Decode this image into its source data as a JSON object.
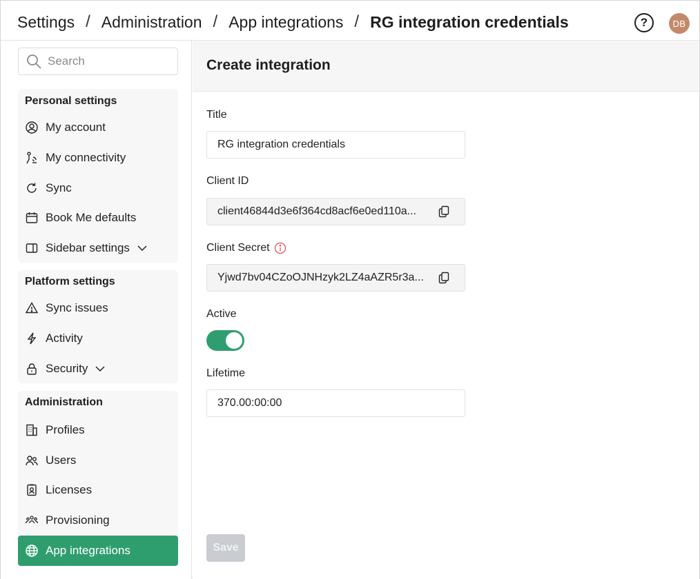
{
  "breadcrumb": [
    "Settings",
    "Administration",
    "App integrations",
    "RG integration credentials"
  ],
  "header": {
    "help_icon": "help-circle-icon",
    "avatar_initials": "DB",
    "avatar_color": "#c28a6a"
  },
  "search": {
    "placeholder": "Search"
  },
  "sidebar": {
    "personal": {
      "title": "Personal settings",
      "items": [
        {
          "label": "My account",
          "icon": "user-circle-icon"
        },
        {
          "label": "My connectivity",
          "icon": "connectivity-icon"
        },
        {
          "label": "Sync",
          "icon": "sync-icon"
        },
        {
          "label": "Book Me defaults",
          "icon": "calendar-icon"
        },
        {
          "label": "Sidebar settings",
          "icon": "sidebar-icon"
        }
      ]
    },
    "platform": {
      "title": "Platform settings",
      "items": [
        {
          "label": "Sync issues",
          "icon": "warning-icon"
        },
        {
          "label": "Activity",
          "icon": "lightning-icon"
        },
        {
          "label": "Security",
          "icon": "lock-icon"
        }
      ]
    },
    "administration": {
      "title": "Administration",
      "items": [
        {
          "label": "Profiles",
          "icon": "building-icon"
        },
        {
          "label": "Users",
          "icon": "users-icon"
        },
        {
          "label": "Licenses",
          "icon": "license-badge-icon"
        },
        {
          "label": "Provisioning",
          "icon": "group-icon"
        },
        {
          "label": "App integrations",
          "icon": "globe-icon",
          "active": true
        }
      ]
    }
  },
  "form": {
    "heading": "Create integration",
    "title_label": "Title",
    "title_value": "RG integration credentials",
    "client_id_label": "Client ID",
    "client_id_value": "client46844d3e6f364cd8acf6e0ed110a...",
    "client_secret_label": "Client Secret",
    "client_secret_value": "Yjwd7bv04CZoOJNHzyk2LZ4aAZR5r3a...",
    "active_label": "Active",
    "active": true,
    "lifetime_label": "Lifetime",
    "lifetime_value": "370.00:00:00",
    "save_label": "Save"
  },
  "colors": {
    "accent": "#2f9e6e",
    "info_red": "#d9534f",
    "save_disabled": "#c9cdd1"
  }
}
